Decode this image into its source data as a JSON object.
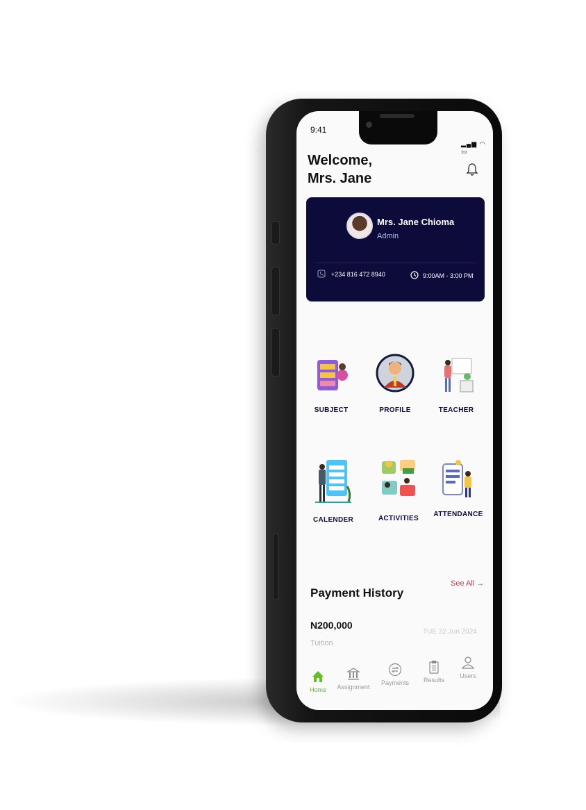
{
  "status": {
    "time": "9:41",
    "icons": "▂▄▆ ◠ ▭"
  },
  "header": {
    "welcome_line1": "Welcome,",
    "welcome_line2": "Mrs. Jane",
    "notification_icon": "bell-icon"
  },
  "profile_card": {
    "name": "Mrs. Jane Chioma",
    "role": "Admin",
    "phone": "+234 816 472 8940",
    "hours": "9:00AM - 3:00 PM",
    "background": "#0c0b3a"
  },
  "tiles": [
    {
      "label": "SUBJECT"
    },
    {
      "label": "PROFILE"
    },
    {
      "label": "TEACHER"
    },
    {
      "label": "CALENDER"
    },
    {
      "label": "ACTIVITIES"
    },
    {
      "label": "ATTENDANCE"
    }
  ],
  "payments": {
    "title": "Payment History",
    "see_all": "See All →",
    "items": [
      {
        "amount": "N200,000",
        "type": "Tuition",
        "date": "TUE 22 Jun 2024"
      }
    ]
  },
  "nav": {
    "active_color": "#5fc31a",
    "items": [
      {
        "label": "Home",
        "icon": "home-icon"
      },
      {
        "label": "Assignment",
        "icon": "bank-icon"
      },
      {
        "label": "Payments",
        "icon": "exchange-icon"
      },
      {
        "label": "Results",
        "icon": "clipboard-icon"
      },
      {
        "label": "Users",
        "icon": "user-icon"
      }
    ]
  }
}
